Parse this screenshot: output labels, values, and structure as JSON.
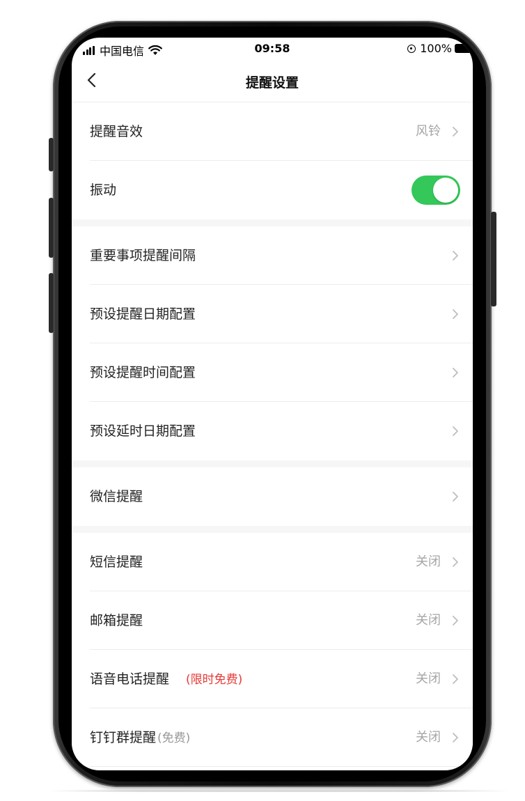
{
  "status_bar": {
    "carrier": "中国电信",
    "time": "09:58",
    "battery": "100%"
  },
  "nav": {
    "title": "提醒设置"
  },
  "colors": {
    "toggle_on": "#34c759",
    "tag_red": "#e53935",
    "value_gray": "#a6a6a6"
  },
  "sections": [
    {
      "rows": [
        {
          "label": "提醒音效",
          "value": "风铃",
          "icon": "chevron-right-icon"
        },
        {
          "label": "振动",
          "toggle": true
        }
      ]
    },
    {
      "rows": [
        {
          "label": "重要事项提醒间隔",
          "icon": "chevron-right-icon"
        },
        {
          "label": "预设提醒日期配置",
          "icon": "chevron-right-icon"
        },
        {
          "label": "预设提醒时间配置",
          "icon": "chevron-right-icon"
        },
        {
          "label": "预设延时日期配置",
          "icon": "chevron-right-icon"
        }
      ]
    },
    {
      "rows": [
        {
          "label": "微信提醒",
          "icon": "chevron-right-icon"
        }
      ]
    },
    {
      "rows": [
        {
          "label": "短信提醒",
          "value": "关闭",
          "icon": "chevron-right-icon"
        },
        {
          "label": "邮箱提醒",
          "value": "关闭",
          "icon": "chevron-right-icon"
        },
        {
          "label": "语音电话提醒",
          "tag": "(限时免费)",
          "value": "关闭",
          "icon": "chevron-right-icon"
        },
        {
          "label": "钉钉群提醒",
          "tag": "(免费)",
          "value": "关闭",
          "icon": "chevron-right-icon"
        }
      ]
    }
  ]
}
